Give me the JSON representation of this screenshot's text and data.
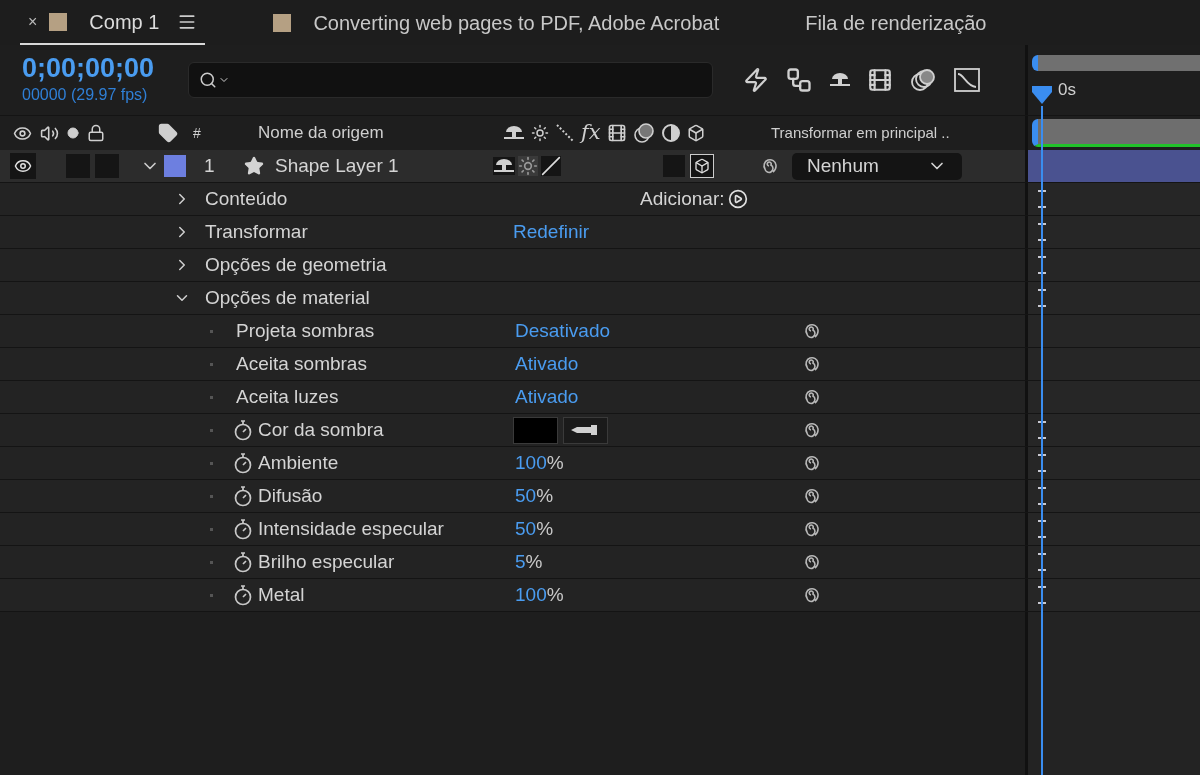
{
  "tabs": [
    {
      "label": "Comp 1",
      "color": "#b5a083",
      "selected": true,
      "close_label": "×"
    },
    {
      "label": "Converting web pages to PDF, Adobe Acrobat",
      "color": "#b5a083",
      "selected": false
    },
    {
      "label": "Fila de renderização",
      "selected": false
    }
  ],
  "timecode": "0;00;00;00",
  "frame_info": "00000 (29.97 fps)",
  "columns": {
    "number": "#",
    "source_name": "Nome da origem",
    "fx": "fx",
    "parent": "Transformar em principal .."
  },
  "layer": {
    "number": "1",
    "name": "Shape Layer 1",
    "color": "#6d7fe0",
    "expanded": true,
    "visible": true,
    "solo": false,
    "locked": false,
    "is_3d": true,
    "parent": "Nenhum"
  },
  "properties": [
    {
      "kind": "group",
      "name": "Conteúdo",
      "expanded": false,
      "action": "Adicionar:"
    },
    {
      "kind": "group",
      "name": "Transformar",
      "expanded": false,
      "link": "Redefinir"
    },
    {
      "kind": "group",
      "name": "Opções de geometria",
      "expanded": false
    },
    {
      "kind": "group",
      "name": "Opções de material",
      "expanded": true,
      "children": [
        {
          "kind": "toggle",
          "name": "Projeta sombras",
          "value": "Desativado"
        },
        {
          "kind": "toggle",
          "name": "Aceita sombras",
          "value": "Ativado"
        },
        {
          "kind": "toggle",
          "name": "Aceita luzes",
          "value": "Ativado"
        },
        {
          "kind": "color",
          "name": "Cor da sombra",
          "color": "#000000"
        },
        {
          "kind": "percent",
          "name": "Ambiente",
          "value": "100",
          "unit": "%"
        },
        {
          "kind": "percent",
          "name": "Difusão",
          "value": "50",
          "unit": "%"
        },
        {
          "kind": "percent",
          "name": "Intensidade especular",
          "value": "50",
          "unit": "%"
        },
        {
          "kind": "percent",
          "name": "Brilho especular",
          "value": "5",
          "unit": "%"
        },
        {
          "kind": "percent",
          "name": "Metal",
          "value": "100",
          "unit": "%"
        }
      ]
    }
  ],
  "timeline": {
    "ruler_label": "0s"
  }
}
